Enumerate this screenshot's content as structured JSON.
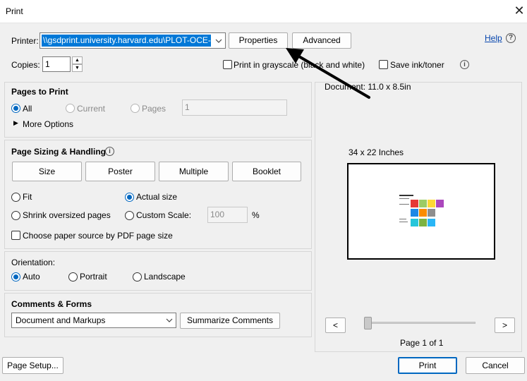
{
  "window": {
    "title": "Print"
  },
  "printer": {
    "label": "Printer:",
    "selected": "\\\\gsdprint.university.harvard.edu\\PLOT-OCE-",
    "properties_label": "Properties",
    "advanced_label": "Advanced",
    "help_label": "Help"
  },
  "copies": {
    "label": "Copies:",
    "value": "1"
  },
  "options": {
    "grayscale_label": "Print in grayscale (black and white)",
    "grayscale_checked": false,
    "save_ink_label": "Save ink/toner",
    "save_ink_checked": false
  },
  "pages_to_print": {
    "heading": "Pages to Print",
    "all_label": "All",
    "current_label": "Current",
    "pages_label": "Pages",
    "pages_value": "1",
    "selected": "All",
    "more_options_label": "More Options"
  },
  "page_sizing": {
    "heading": "Page Sizing & Handling",
    "tabs": [
      "Size",
      "Poster",
      "Multiple",
      "Booklet"
    ],
    "fit_label": "Fit",
    "actual_size_label": "Actual size",
    "shrink_label": "Shrink oversized pages",
    "custom_scale_label": "Custom Scale:",
    "custom_scale_value": "100",
    "percent_label": "%",
    "selected": "Actual size",
    "paper_source_label": "Choose paper source by PDF page size",
    "paper_source_checked": false
  },
  "orientation": {
    "heading": "Orientation:",
    "auto_label": "Auto",
    "portrait_label": "Portrait",
    "landscape_label": "Landscape",
    "selected": "Auto"
  },
  "comments_forms": {
    "heading": "Comments & Forms",
    "selected": "Document and Markups",
    "summarize_label": "Summarize Comments"
  },
  "preview": {
    "document_size": "Document: 11.0 x 8.5in",
    "paper_size": "34 x 22 Inches",
    "prev_label": "<",
    "next_label": ">",
    "page_indicator": "Page 1 of 1",
    "swatch_colors": [
      "#e53935",
      "#9ccc65",
      "#fdd835",
      "#ab47bc",
      "#1e88e5",
      "#fb8c00",
      "#8e8e8e",
      "#26c6da",
      "#7cb342",
      "#29b6f6",
      "#ffb74d"
    ]
  },
  "footer": {
    "page_setup_label": "Page Setup...",
    "print_label": "Print",
    "cancel_label": "Cancel"
  },
  "icons": {
    "close": "close-icon",
    "help": "help-question-icon",
    "info": "info-icon",
    "dropdown": "chevron-down-icon",
    "expand": "triangle-right-icon",
    "annotation": "arrow-annotation"
  }
}
